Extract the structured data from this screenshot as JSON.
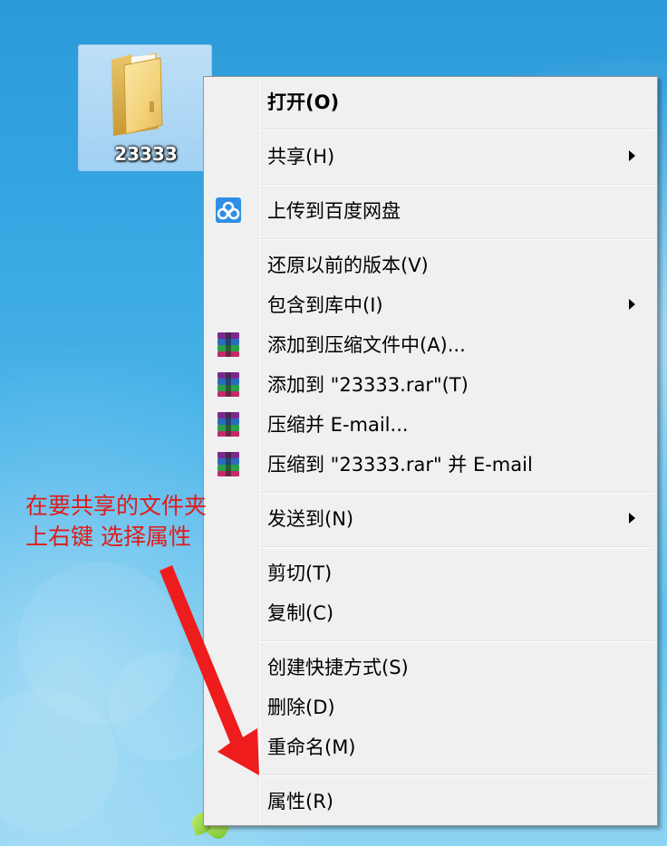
{
  "desktop": {
    "folder_label": "23333"
  },
  "menu": {
    "items": [
      {
        "label": "打开(O)",
        "bold": true,
        "submenu": false,
        "icon": null
      },
      {
        "label": "共享(H)",
        "submenu": true,
        "icon": null
      },
      {
        "label": "上传到百度网盘",
        "submenu": false,
        "icon": "baidu-netdisk-icon"
      },
      {
        "label": "还原以前的版本(V)",
        "submenu": false,
        "icon": null
      },
      {
        "label": "包含到库中(I)",
        "submenu": true,
        "icon": null
      },
      {
        "label": "添加到压缩文件中(A)...",
        "submenu": false,
        "icon": "winrar-icon"
      },
      {
        "label": "添加到 \"23333.rar\"(T)",
        "submenu": false,
        "icon": "winrar-icon"
      },
      {
        "label": "压缩并 E-mail...",
        "submenu": false,
        "icon": "winrar-icon"
      },
      {
        "label": "压缩到 \"23333.rar\" 并 E-mail",
        "submenu": false,
        "icon": "winrar-icon"
      },
      {
        "label": "发送到(N)",
        "submenu": true,
        "icon": null
      },
      {
        "label": "剪切(T)",
        "submenu": false,
        "icon": null
      },
      {
        "label": "复制(C)",
        "submenu": false,
        "icon": null
      },
      {
        "label": "创建快捷方式(S)",
        "submenu": false,
        "icon": null
      },
      {
        "label": "删除(D)",
        "submenu": false,
        "icon": null
      },
      {
        "label": "重命名(M)",
        "submenu": false,
        "icon": null
      },
      {
        "label": "属性(R)",
        "submenu": false,
        "icon": null
      }
    ]
  },
  "annotation": {
    "line1": "在要共享的文件夹",
    "line2": "上右键 选择属性",
    "color": "#e01b1b"
  },
  "colors": {
    "menu_bg": "#f0f0f0",
    "menu_border": "#979797",
    "desktop_blue": "#36a6e2",
    "arrow_red": "#ee1c1c"
  }
}
